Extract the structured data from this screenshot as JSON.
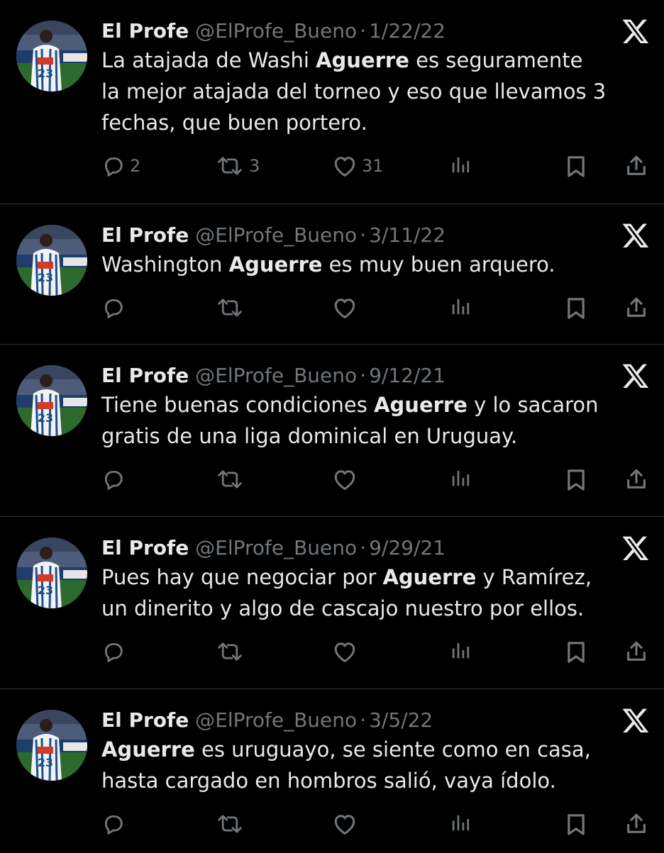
{
  "icons": {
    "reply": "reply-icon",
    "retweet": "retweet-icon",
    "like": "heart-icon",
    "views": "views-icon",
    "bookmark": "bookmark-icon",
    "share": "share-icon",
    "platform": "x-logo-icon"
  },
  "colors": {
    "background": "#000000",
    "text": "#e7e9ea",
    "muted": "#71767b",
    "divider": "#2f3336"
  },
  "tweets": [
    {
      "name": "El Profe",
      "handle": "@ElProfe_Bueno",
      "separator": "·",
      "date": "1/22/22",
      "text_before": "La atajada de Washi ",
      "keyword": "Aguerre",
      "text_after": " es seguramente la mejor atajada del torneo y eso que llevamos 3 fechas, que buen portero.",
      "replies": "2",
      "retweets": "3",
      "likes": "31"
    },
    {
      "name": "El Profe",
      "handle": "@ElProfe_Bueno",
      "separator": "·",
      "date": "3/11/22",
      "text_before": "Washington ",
      "keyword": "Aguerre",
      "text_after": " es muy buen arquero.",
      "replies": "",
      "retweets": "",
      "likes": ""
    },
    {
      "name": "El Profe",
      "handle": "@ElProfe_Bueno",
      "separator": "·",
      "date": "9/12/21",
      "text_before": "Tiene buenas condiciones ",
      "keyword": "Aguerre",
      "text_after": " y lo sacaron gratis de una liga dominical en Uruguay.",
      "replies": "",
      "retweets": "",
      "likes": ""
    },
    {
      "name": "El Profe",
      "handle": "@ElProfe_Bueno",
      "separator": "·",
      "date": "9/29/21",
      "text_before": "Pues hay que negociar por ",
      "keyword": "Aguerre",
      "text_after": " y Ramírez, un dinerito y algo de cascajo nuestro por ellos.",
      "replies": "",
      "retweets": "",
      "likes": ""
    },
    {
      "name": "El Profe",
      "handle": "@ElProfe_Bueno",
      "separator": "·",
      "date": "3/5/22",
      "text_before": "",
      "keyword": "Aguerre",
      "text_after": " es uruguayo, se siente como en casa, hasta cargado en hombros salió, vaya ídolo.",
      "replies": "",
      "retweets": "",
      "likes": ""
    }
  ]
}
